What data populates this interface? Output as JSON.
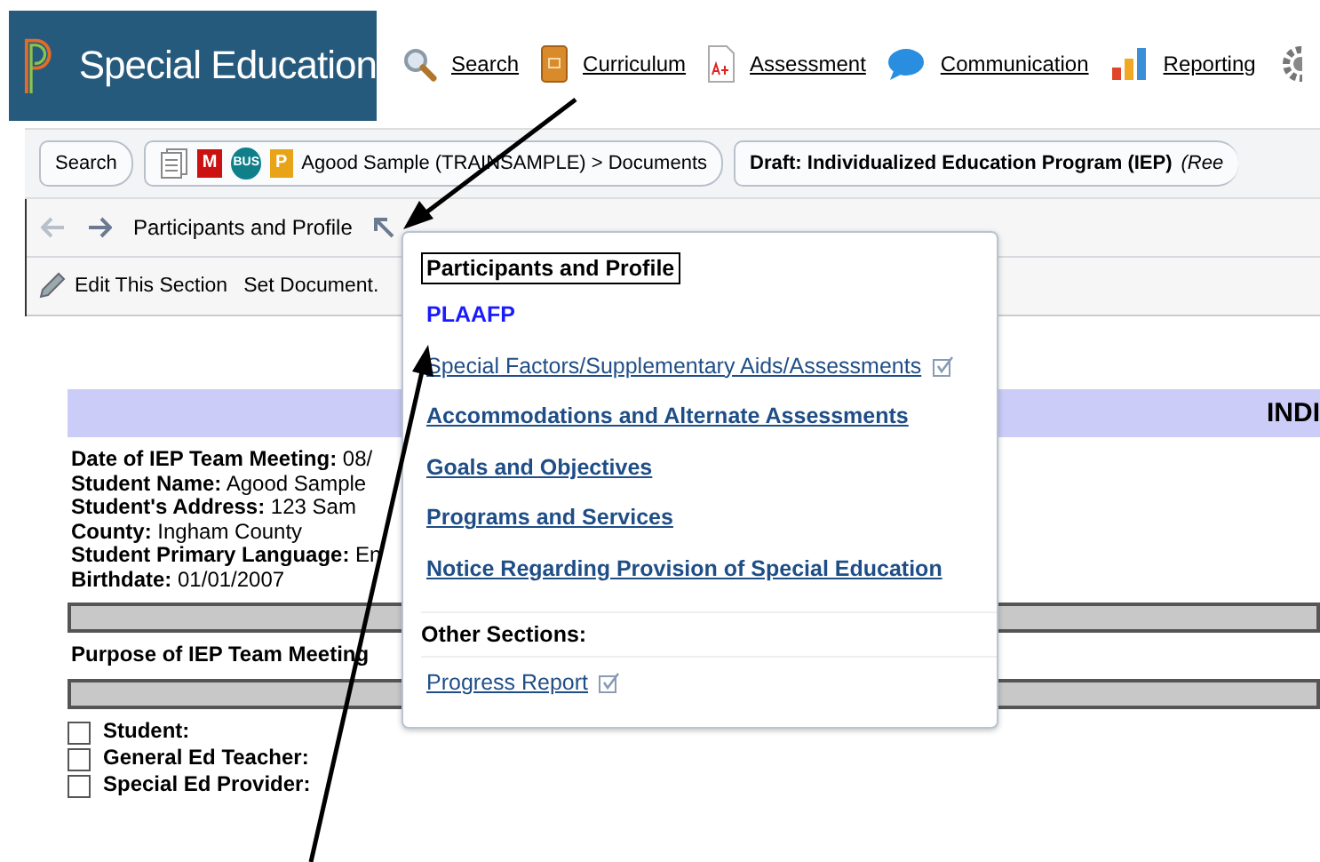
{
  "header": {
    "title": "Special Education",
    "nav": [
      {
        "label": "Search"
      },
      {
        "label": "Curriculum"
      },
      {
        "label": "Assessment"
      },
      {
        "label": "Communication"
      },
      {
        "label": "Reporting"
      }
    ]
  },
  "breadcrumbs": [
    {
      "kind": "plain",
      "label": "Search"
    },
    {
      "kind": "student",
      "label": "Agood Sample (TRAINSAMPLE) > Documents",
      "badges": [
        {
          "label": "M",
          "color": "#cc1111"
        },
        {
          "label": "BUS",
          "color": "#0f7f8a"
        },
        {
          "label": "P",
          "color": "#e8a317"
        }
      ]
    },
    {
      "kind": "document",
      "label": "Draft: Individualized Education Program (IEP)",
      "note": "(Ree"
    }
  ],
  "section_nav": {
    "title": "Participants and Profile"
  },
  "toolbar": [
    {
      "label": "Edit This Section"
    },
    {
      "label": "Set Document."
    }
  ],
  "menu": {
    "current": "Participants and Profile",
    "items": [
      {
        "label": "PLAAFP",
        "selected": true,
        "checked": false
      },
      {
        "label": "Special Factors/Supplementary Aids/Assessments",
        "selected": false,
        "checked": true
      },
      {
        "label": "Accommodations and Alternate Assessments",
        "selected": false,
        "checked": false
      },
      {
        "label": "Goals and Objectives",
        "selected": false,
        "checked": false
      },
      {
        "label": "Programs and Services",
        "selected": false,
        "checked": false
      },
      {
        "label": "Notice Regarding Provision of Special Education",
        "selected": false,
        "checked": false
      }
    ],
    "other_heading": "Other Sections:",
    "other_items": [
      {
        "label": "Progress Report",
        "selected": false,
        "checked": true
      }
    ]
  },
  "document": {
    "banner": "INDI",
    "fields": [
      {
        "label": "Date of IEP Team Meeting:",
        "value": "08/"
      },
      {
        "label": "Student Name:",
        "value": "Agood Sample"
      },
      {
        "label": "Student's Address:",
        "value": "123 Sam"
      },
      {
        "label": "County:",
        "value": "Ingham County"
      },
      {
        "label": "Student Primary Language:",
        "value": "En"
      },
      {
        "label": "Birthdate:",
        "value": "01/01/2007"
      }
    ],
    "purpose": "Purpose of IEP Team Meeting",
    "participants": [
      {
        "label": "Student:",
        "checked": false
      },
      {
        "label": "General Ed Teacher:",
        "checked": false
      },
      {
        "label": "Special Ed Provider:",
        "checked": false
      }
    ]
  }
}
